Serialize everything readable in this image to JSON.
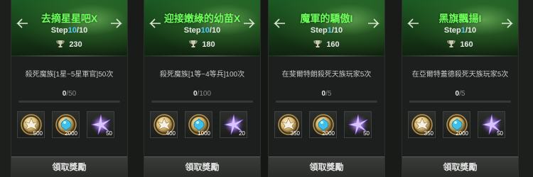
{
  "cards": [
    {
      "title": "去摘星星吧X",
      "step_label": "Step",
      "step_current": "10",
      "step_total": "/10",
      "score": "230",
      "description": "殺死魔族[1星~5星軍官]50次",
      "progress_current": "0",
      "progress_total": "/50",
      "rewards": [
        {
          "icon": "gold-leaf-coin-icon",
          "amount": "500"
        },
        {
          "icon": "blue-gem-coin-icon",
          "amount": "2000"
        },
        {
          "icon": "purple-star-icon",
          "amount": "50"
        }
      ],
      "claim_label": "領取獎勵"
    },
    {
      "title": "迎接嫩綠的幼苗X",
      "step_label": "Step",
      "step_current": "10",
      "step_total": "/10",
      "score": "180",
      "description": "殺死魔族[1等~4等兵]100次",
      "progress_current": "0",
      "progress_total": "/100",
      "rewards": [
        {
          "icon": "gold-leaf-coin-icon",
          "amount": "400"
        },
        {
          "icon": "blue-gem-coin-icon",
          "amount": "1000"
        },
        {
          "icon": "purple-star-icon",
          "amount": "20"
        }
      ],
      "claim_label": "領取獎勵"
    },
    {
      "title": "魔軍的驕傲I",
      "step_label": "Step",
      "step_current": "1",
      "step_total": "/10",
      "score": "160",
      "description": "在斐爾特朗殺死天族玩家5次",
      "progress_current": "0",
      "progress_total": "/5",
      "rewards": [
        {
          "icon": "gold-leaf-coin-icon",
          "amount": "350"
        },
        {
          "icon": "blue-gem-coin-icon",
          "amount": "2000"
        },
        {
          "icon": "purple-star-icon",
          "amount": "50"
        }
      ],
      "claim_label": "領取獎勵"
    },
    {
      "title": "黑旗飄揚I",
      "step_label": "Step",
      "step_current": "1",
      "step_total": "/10",
      "score": "160",
      "description": "在亞爾特蓋德殺死天族玩家5次",
      "progress_current": "0",
      "progress_total": "/5",
      "rewards": [
        {
          "icon": "gold-leaf-coin-icon",
          "amount": "350"
        },
        {
          "icon": "blue-gem-coin-icon",
          "amount": "2000"
        },
        {
          "icon": "purple-star-icon",
          "amount": "50"
        }
      ],
      "claim_label": "領取獎勵"
    }
  ],
  "colors": {
    "title_green": "#6dff5a",
    "step_blue": "#56c8ff",
    "panel_bg": "#1d1f1e"
  }
}
